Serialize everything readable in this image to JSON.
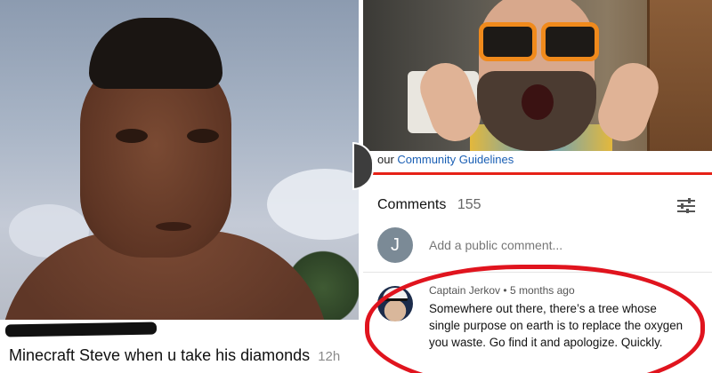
{
  "left_panel": {
    "caption": "Minecraft Steve when u take his diamonds",
    "time": "12h"
  },
  "right_panel": {
    "guidelines_prefix": "our",
    "guidelines_link": "Community Guidelines",
    "comments_label": "Comments",
    "comments_count": "155",
    "add_comment_avatar": "J",
    "add_comment_placeholder": "Add a public comment...",
    "comment": {
      "author": "Captain Jerkov",
      "age": "5 months ago",
      "text": "Somewhere out there, there’s a tree whose single purpose on earth is to replace the oxygen you waste. Go find it and apologize. Quickly."
    }
  },
  "colors": {
    "highlight_circle": "#e0141e",
    "link": "#1a5fb4",
    "progress_bar": "#e62117"
  }
}
